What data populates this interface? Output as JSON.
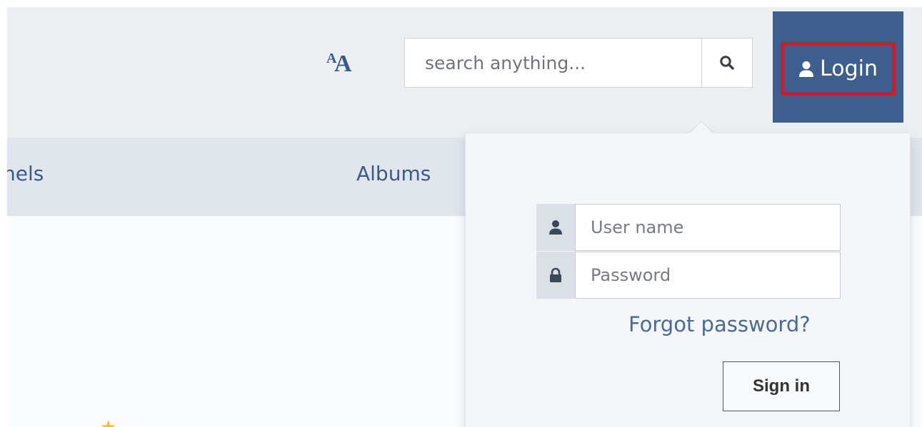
{
  "header": {
    "font_size_toggle": {
      "small": "A",
      "large": "A"
    },
    "search": {
      "placeholder": "search anything...",
      "icon": "search-icon"
    },
    "login": {
      "label": "Login",
      "icon": "user-icon"
    }
  },
  "nav": {
    "items": [
      {
        "label": "nels"
      },
      {
        "label": "Albums"
      }
    ]
  },
  "login_dropdown": {
    "username": {
      "placeholder": "User name",
      "icon": "user-icon"
    },
    "password": {
      "placeholder": "Password",
      "icon": "lock-icon"
    },
    "forgot_label": "Forgot password?",
    "signin_label": "Sign in"
  },
  "colors": {
    "header_bg": "#edf0f3",
    "nav_bg": "#e1e6ed",
    "login_bg": "#3e5e8e",
    "highlight": "#e8121b",
    "link": "#3d5a85",
    "star": "#f0c020"
  }
}
